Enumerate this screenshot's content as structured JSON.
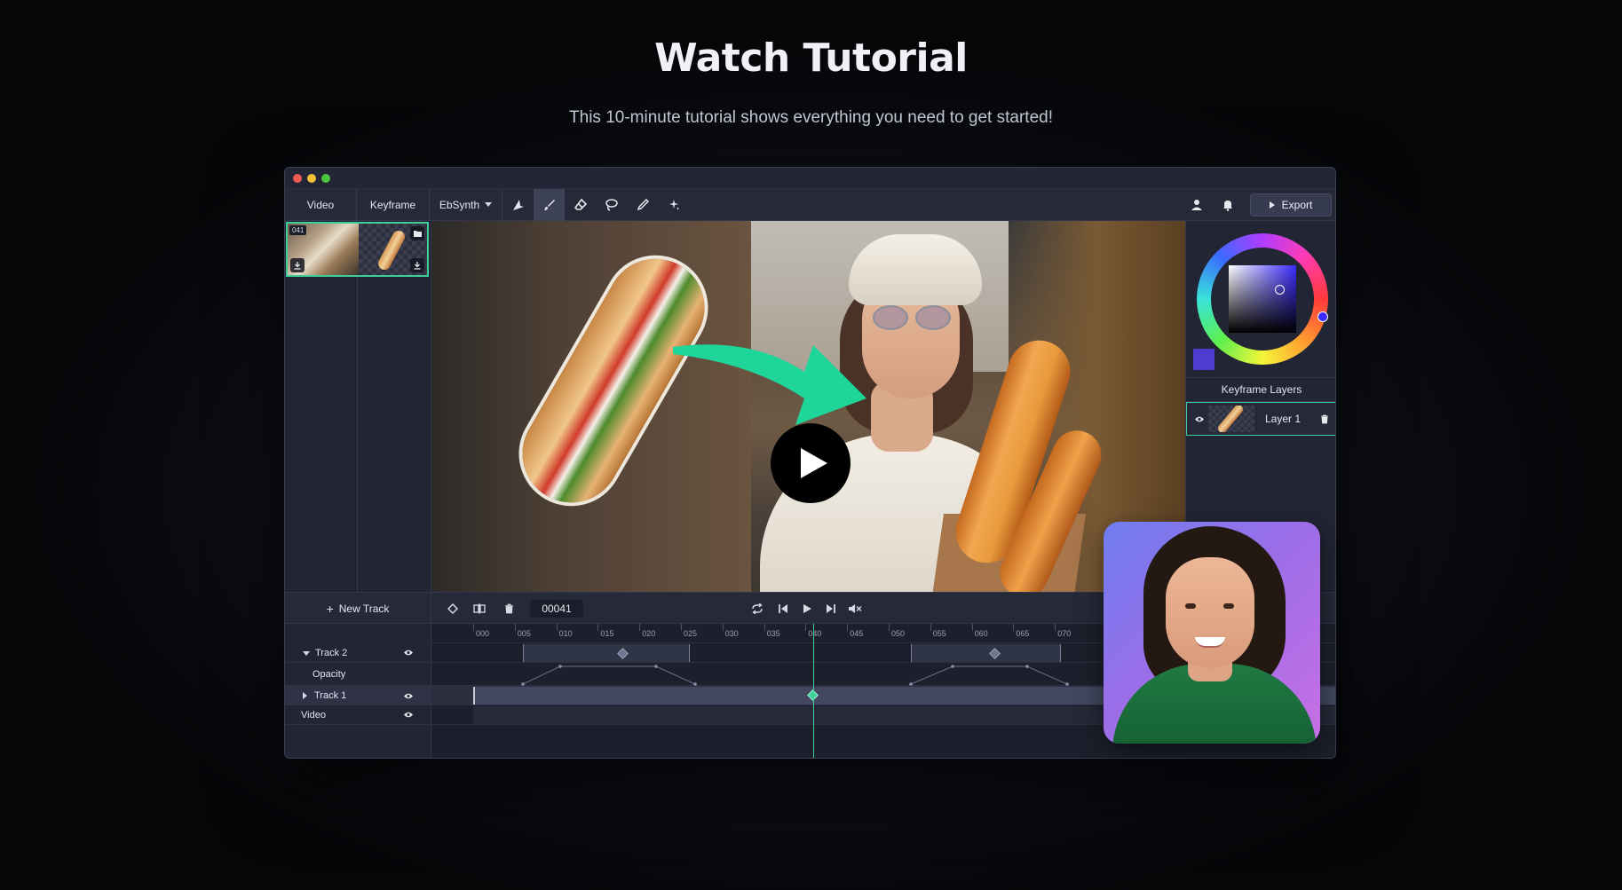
{
  "hero": {
    "title": "Watch Tutorial",
    "subtitle": "This 10-minute tutorial shows everything you need to get started!"
  },
  "toolbar": {
    "tabs": [
      "Video",
      "Keyframe",
      "EbSynth"
    ],
    "tools": [
      "move-icon",
      "brush-icon",
      "eraser-icon",
      "lasso-icon",
      "eyedropper-icon",
      "magic-wand-icon"
    ],
    "active_tool": "brush-icon",
    "export_label": "Export"
  },
  "left_panel": {
    "frame_badge": "041"
  },
  "right_panel": {
    "selected_color": "#4f3bd0",
    "layers_header": "Keyframe Layers",
    "layers": [
      {
        "label": "Layer 1"
      }
    ]
  },
  "timeline": {
    "new_track_label": "New Track",
    "current_frame": "00041",
    "ruler_ticks": [
      "000",
      "005",
      "010",
      "015",
      "020",
      "025",
      "030",
      "035",
      "040",
      "045",
      "050",
      "055",
      "060",
      "065",
      "070"
    ],
    "tracks": [
      {
        "label": "Track 2",
        "expanded": true
      },
      {
        "label": "Opacity"
      },
      {
        "label": "Track 1",
        "expanded": false
      },
      {
        "label": "Video"
      }
    ]
  },
  "colors": {
    "accent": "#3ccf9a",
    "background": "#0f111a"
  }
}
